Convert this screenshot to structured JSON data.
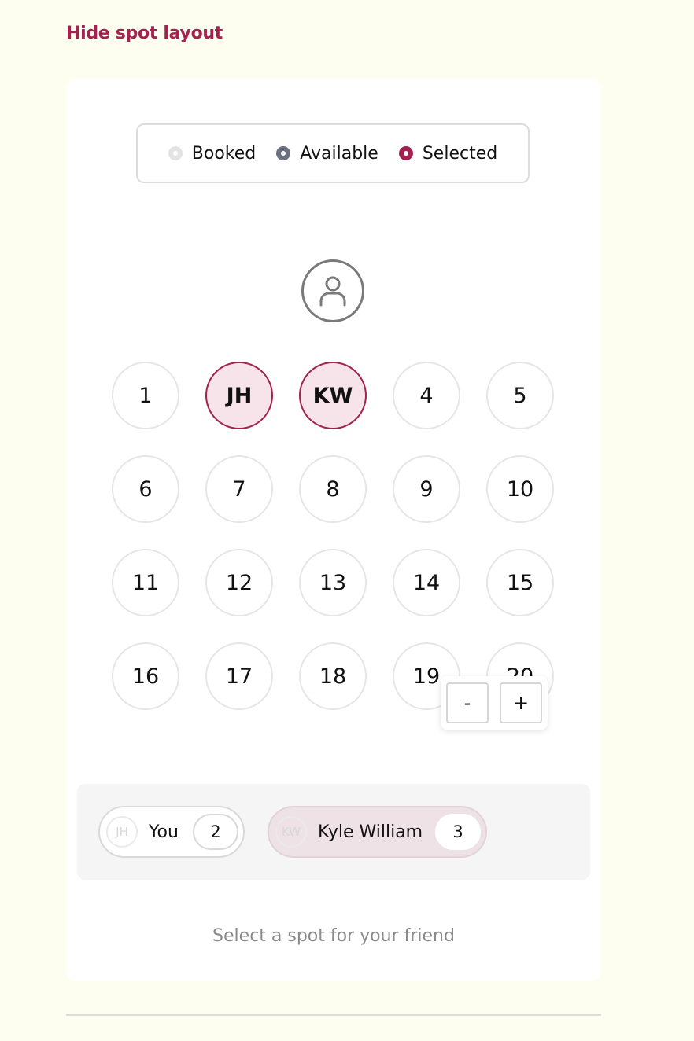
{
  "header": {
    "hide_link": "Hide spot layout"
  },
  "legend": [
    {
      "label": "Booked",
      "status": "booked",
      "color": "#e3e3e3"
    },
    {
      "label": "Available",
      "status": "available",
      "color": "#6b7080"
    },
    {
      "label": "Selected",
      "status": "selected",
      "color": "#a3224f"
    }
  ],
  "host": {
    "icon": "person-icon"
  },
  "spots": [
    {
      "label": "1",
      "state": "available"
    },
    {
      "label": "JH",
      "state": "selected"
    },
    {
      "label": "KW",
      "state": "selected"
    },
    {
      "label": "4",
      "state": "available"
    },
    {
      "label": "5",
      "state": "available"
    },
    {
      "label": "6",
      "state": "available"
    },
    {
      "label": "7",
      "state": "available"
    },
    {
      "label": "8",
      "state": "available"
    },
    {
      "label": "9",
      "state": "available"
    },
    {
      "label": "10",
      "state": "available"
    },
    {
      "label": "11",
      "state": "available"
    },
    {
      "label": "12",
      "state": "available"
    },
    {
      "label": "13",
      "state": "available"
    },
    {
      "label": "14",
      "state": "available"
    },
    {
      "label": "15",
      "state": "available"
    },
    {
      "label": "16",
      "state": "available"
    },
    {
      "label": "17",
      "state": "available"
    },
    {
      "label": "18",
      "state": "available"
    },
    {
      "label": "19",
      "state": "available"
    },
    {
      "label": "20",
      "state": "available"
    }
  ],
  "zoom": {
    "minus": "-",
    "plus": "+"
  },
  "participants": [
    {
      "initials": "JH",
      "name": "You",
      "spot": "2"
    },
    {
      "initials": "KW",
      "name": "Kyle William",
      "spot": "3"
    }
  ],
  "hint": "Select a spot for your friend",
  "colors": {
    "accent": "#a3224f",
    "background": "#fefef0"
  }
}
